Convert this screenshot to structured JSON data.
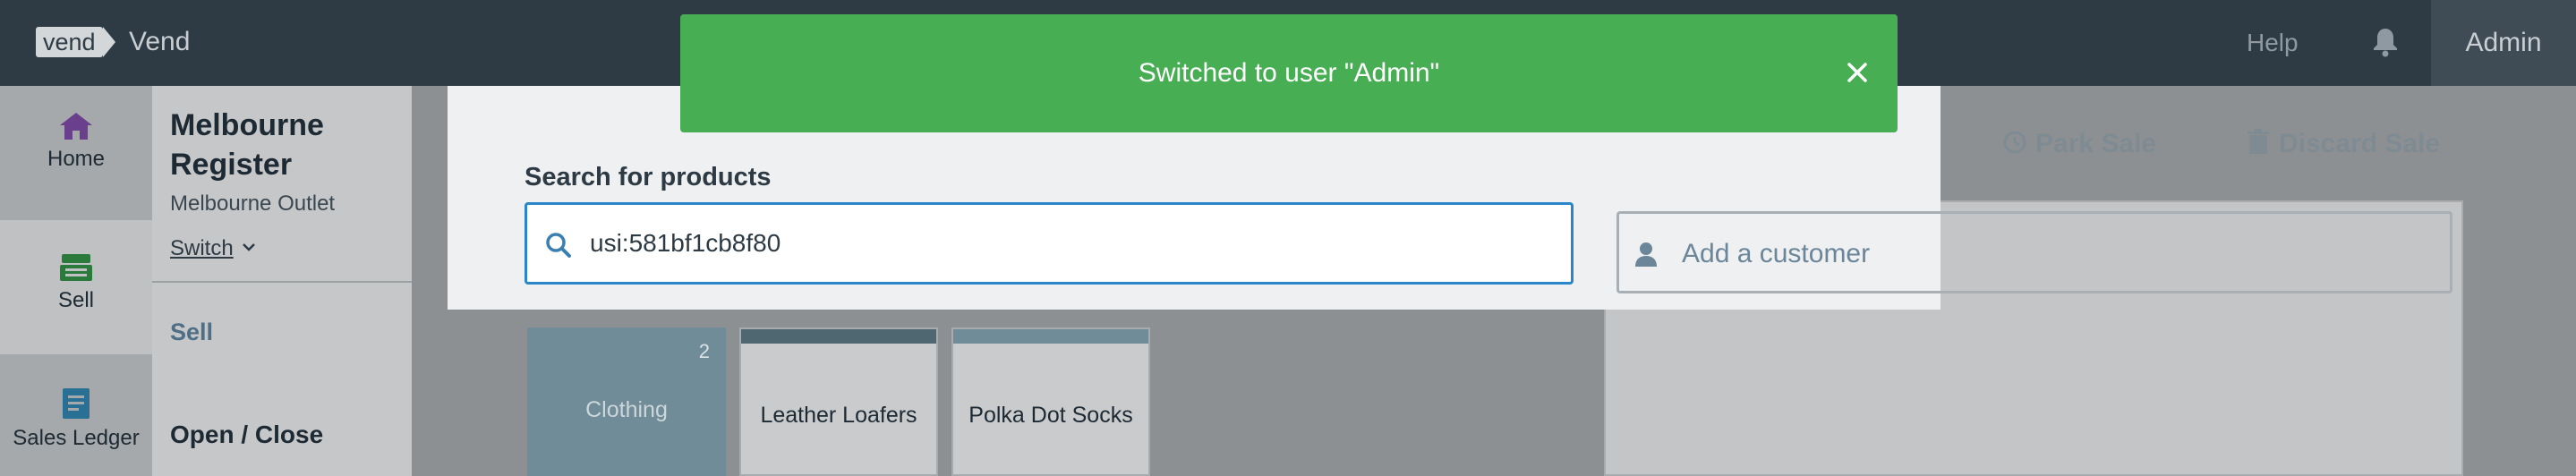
{
  "header": {
    "logo_text": "vend",
    "brand": "Vend",
    "help": "Help",
    "admin": "Admin"
  },
  "nav": {
    "items": [
      {
        "label": "Home",
        "icon": "home-icon"
      },
      {
        "label": "Sell",
        "icon": "register-icon"
      },
      {
        "label": "Sales Ledger",
        "icon": "ledger-icon"
      }
    ]
  },
  "register": {
    "title": "Melbourne Register",
    "outlet": "Melbourne Outlet",
    "switch": "Switch",
    "menu_sell": "Sell",
    "menu_open_close": "Open / Close"
  },
  "toast": {
    "message": "Switched to user \"Admin\""
  },
  "search": {
    "label": "Search for products",
    "value": "usi:581bf1cb8f80"
  },
  "actions": {
    "park": "Park Sale",
    "discard": "Discard Sale"
  },
  "customer": {
    "placeholder": "Add a customer"
  },
  "tiles": [
    {
      "name": "Clothing",
      "count": "2",
      "color": "#6f8c98"
    },
    {
      "name": "Leather Loafers",
      "color": "#4f6770"
    },
    {
      "name": "Polka Dot Socks",
      "color": "#6f8c98"
    }
  ],
  "colors": {
    "topbar": "#2e3b45",
    "toast": "#48ae54",
    "accent": "#2a86c8"
  }
}
